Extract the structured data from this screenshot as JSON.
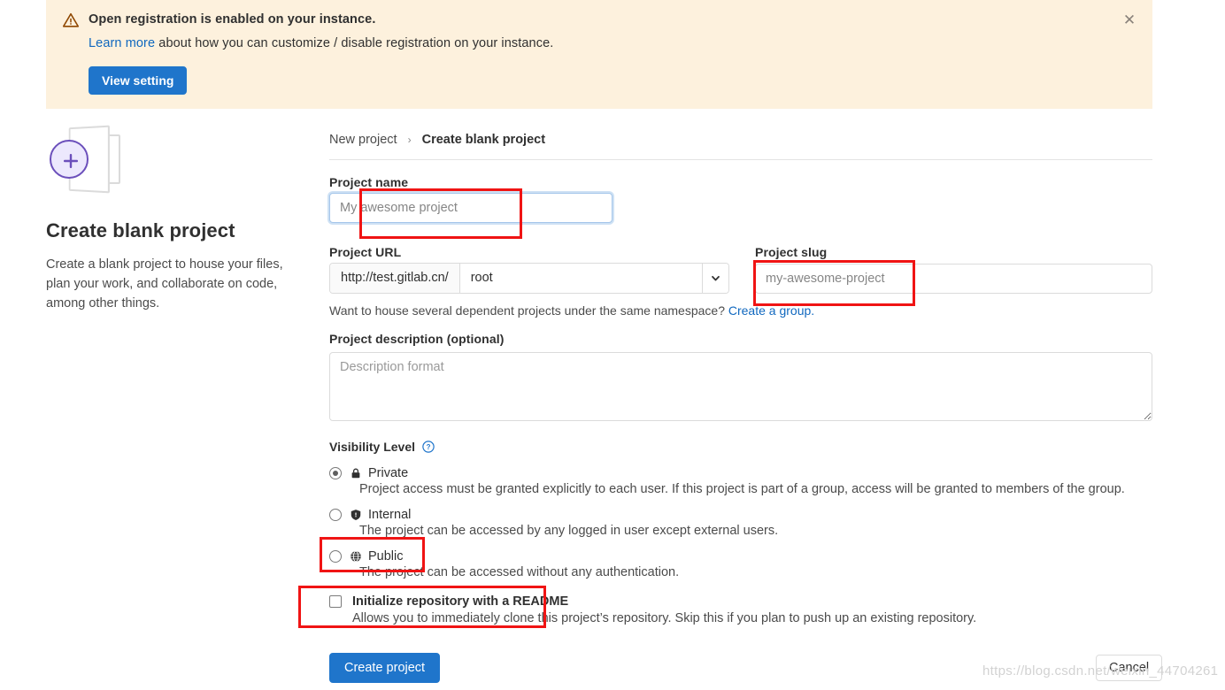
{
  "alert": {
    "icon": "warning-triangle-icon",
    "title": "Open registration is enabled on your instance.",
    "link_text": "Learn more",
    "sub_rest": " about how you can customize / disable registration on your instance.",
    "button_label": "View setting",
    "close_icon": "close-icon",
    "bg_color": "#fdf1dd",
    "icon_color": "#8f4700",
    "button_color": "#1f75cb"
  },
  "left_panel": {
    "icon": "new-blank-project-icon",
    "title": "Create blank project",
    "description": "Create a blank project to house your files, plan your work, and collaborate on code, among other things."
  },
  "breadcrumb": {
    "parent": "New project",
    "separator": "›",
    "current": "Create blank project"
  },
  "form": {
    "project_name": {
      "label": "Project name",
      "placeholder": "My awesome project",
      "value": ""
    },
    "project_url": {
      "label": "Project URL",
      "prefix": "http://test.gitlab.cn/",
      "namespace": "root",
      "caret_icon": "chevron-down-icon"
    },
    "project_slug": {
      "label": "Project slug",
      "placeholder": "my-awesome-project",
      "value": ""
    },
    "url_hint": {
      "text": "Want to house several dependent projects under the same namespace? ",
      "link_text": "Create a group."
    },
    "description": {
      "label": "Project description (optional)",
      "placeholder": "Description format",
      "value": ""
    },
    "visibility": {
      "label": "Visibility Level",
      "help_icon": "question-circle-icon",
      "options": [
        {
          "id": "private",
          "name": "Private",
          "icon": "lock-icon",
          "selected": true,
          "description": "Project access must be granted explicitly to each user. If this project is part of a group, access will be granted to members of the group."
        },
        {
          "id": "internal",
          "name": "Internal",
          "icon": "shield-icon",
          "selected": false,
          "description": "The project can be accessed by any logged in user except external users."
        },
        {
          "id": "public",
          "name": "Public",
          "icon": "globe-icon",
          "selected": false,
          "description": "The project can be accessed without any authentication."
        }
      ]
    },
    "readme": {
      "label": "Initialize repository with a README",
      "description": "Allows you to immediately clone this project’s repository. Skip this if you plan to push up an existing repository.",
      "checked": false
    },
    "submit_label": "Create project",
    "cancel_label": "Cancel"
  },
  "annotations": {
    "color": "#f01414",
    "boxes": [
      "project-name-input",
      "project-slug-input",
      "public-visibility-option",
      "readme-checkbox"
    ]
  },
  "watermark": {
    "text": "https://blog.csdn.net/weixin_44704261"
  }
}
